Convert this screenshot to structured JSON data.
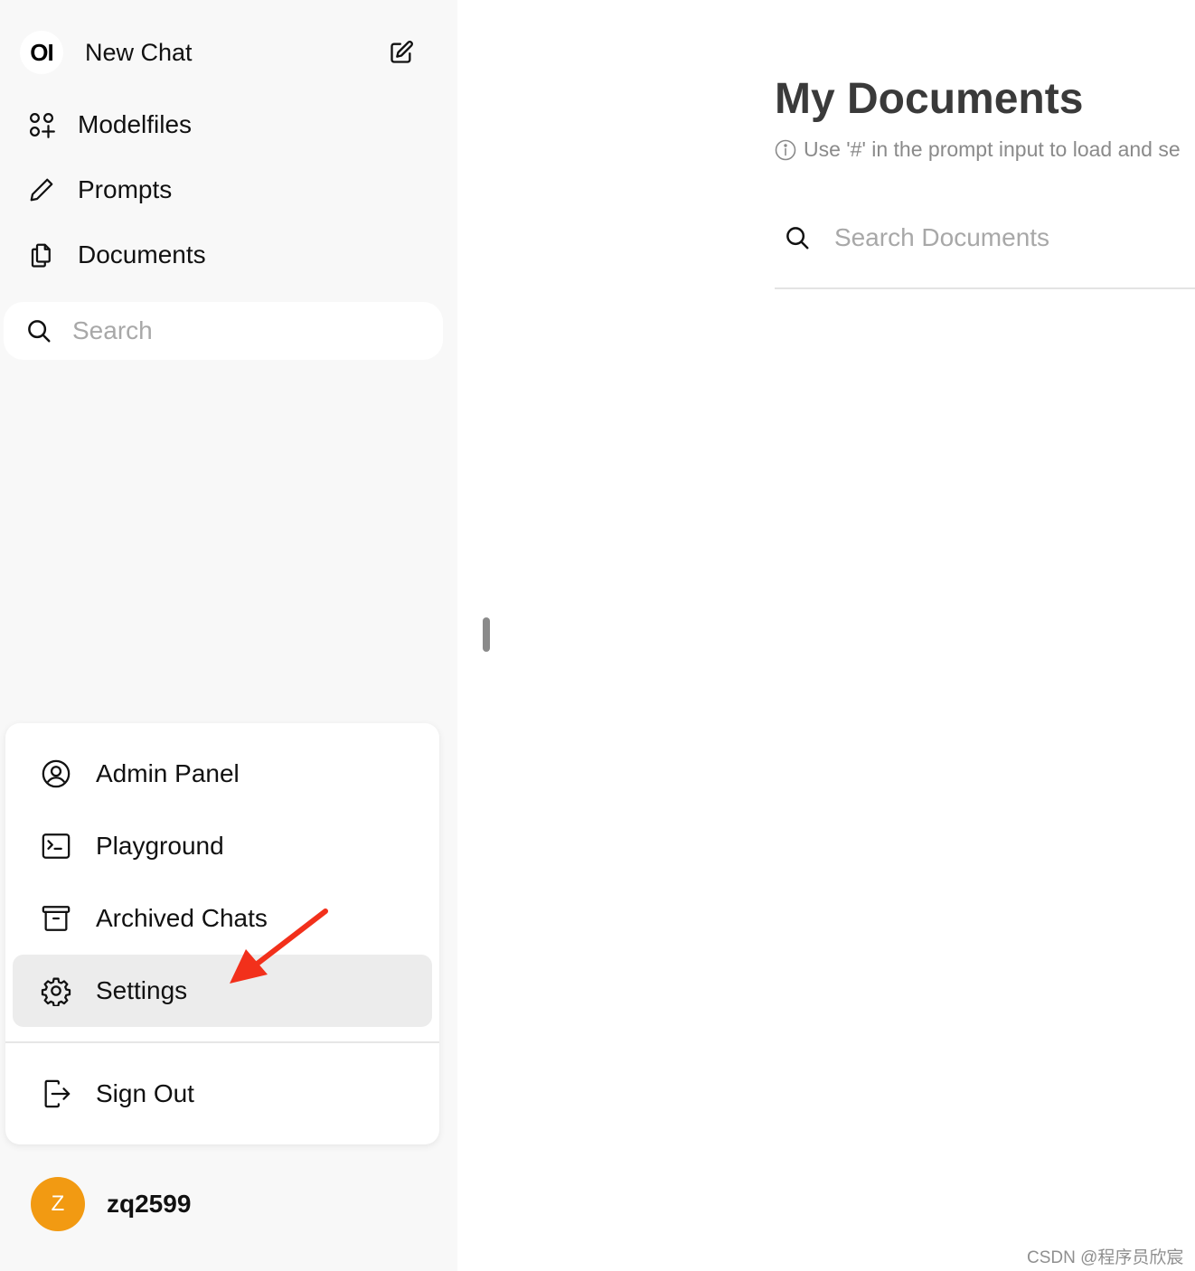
{
  "sidebar": {
    "logo_text": "OI",
    "new_chat_label": "New Chat",
    "nav": [
      {
        "label": "Modelfiles",
        "icon": "modelfiles-icon"
      },
      {
        "label": "Prompts",
        "icon": "pencil-icon"
      },
      {
        "label": "Documents",
        "icon": "documents-icon"
      }
    ],
    "search": {
      "placeholder": "Search",
      "value": ""
    }
  },
  "menu": {
    "items": [
      {
        "label": "Admin Panel",
        "icon": "user-circle-icon"
      },
      {
        "label": "Playground",
        "icon": "terminal-icon"
      },
      {
        "label": "Archived Chats",
        "icon": "archive-icon"
      },
      {
        "label": "Settings",
        "icon": "gear-icon",
        "active": true
      }
    ],
    "sign_out_label": "Sign Out"
  },
  "user": {
    "avatar_initial": "Z",
    "name": "zq2599",
    "avatar_color": "#f29a12"
  },
  "main": {
    "title": "My Documents",
    "info_text": "Use '#' in the prompt input to load and se",
    "search": {
      "placeholder": "Search Documents",
      "value": ""
    }
  },
  "annotation": {
    "arrow_color": "#f2301b"
  },
  "watermark": "CSDN @程序员欣宸"
}
